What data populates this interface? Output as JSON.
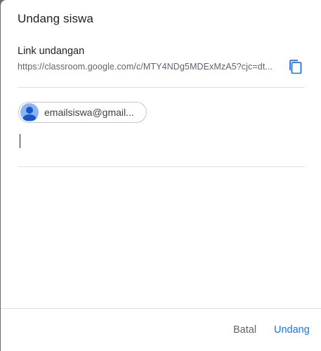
{
  "dialog": {
    "title": "Undang siswa",
    "link_section": {
      "label": "Link undangan",
      "url": "https://classroom.google.com/c/MTY4NDg5MDExMzA5?cjc=dt..."
    },
    "recipients": [
      {
        "label": "emailsiswa@gmail..."
      }
    ],
    "buttons": {
      "cancel": "Batal",
      "invite": "Undang"
    }
  },
  "colors": {
    "accent": "#1a73e8",
    "text_primary": "#202124",
    "text_secondary": "#5f6368",
    "avatar_bg": "#8ab4f8"
  },
  "icons": {
    "copy": "copy-icon",
    "avatar": "person-avatar-icon"
  }
}
